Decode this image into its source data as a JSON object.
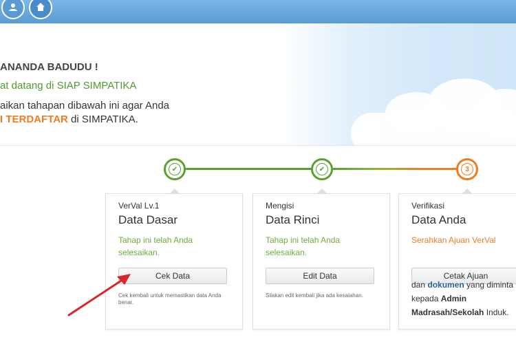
{
  "topbar": {
    "nav": [
      {
        "icon": "user-icon"
      },
      {
        "icon": "home-icon",
        "active": true
      }
    ]
  },
  "welcome": {
    "name": "ANANDA BADUDU !",
    "greeting": "at datang di SIAP SIMPATIKA",
    "line1": "aikan tahapan dibawah ini agar Anda",
    "line2_highlight": "I TERDAFTAR",
    "line2_rest": " di SIMPATIKA."
  },
  "steps": [
    {
      "label": "VerVal Lv.1",
      "title": "Data Dasar",
      "status": "Tahap ini telah Anda selesaikan.",
      "button": "Cek Data",
      "note": "Cek kembali untuk memastikan data Anda benar.",
      "state": "done"
    },
    {
      "label": "Mengisi",
      "title": "Data Rinci",
      "status": "Tahap ini telah Anda selesaikan.",
      "button": "Edit Data",
      "note": "Silakan edit kembali jika ada kesalahan.",
      "state": "done"
    },
    {
      "label": "Verifikasi",
      "title": "Data Anda",
      "status": "Serahkan Ajuan VerVal",
      "button": "Cetak Ajuan",
      "desc_prefix": "dan ",
      "desc_link": "dokumen",
      "desc_mid": " yang diminta kepada ",
      "desc_bold": "Admin Madrasah/Sekolah",
      "desc_suffix": " Induk.",
      "step_number": "3",
      "state": "current"
    }
  ],
  "colors": {
    "done": "#5aa12f",
    "current": "#f07c22",
    "topbar": "#5a9bd4",
    "arrow": "#d8262a"
  }
}
